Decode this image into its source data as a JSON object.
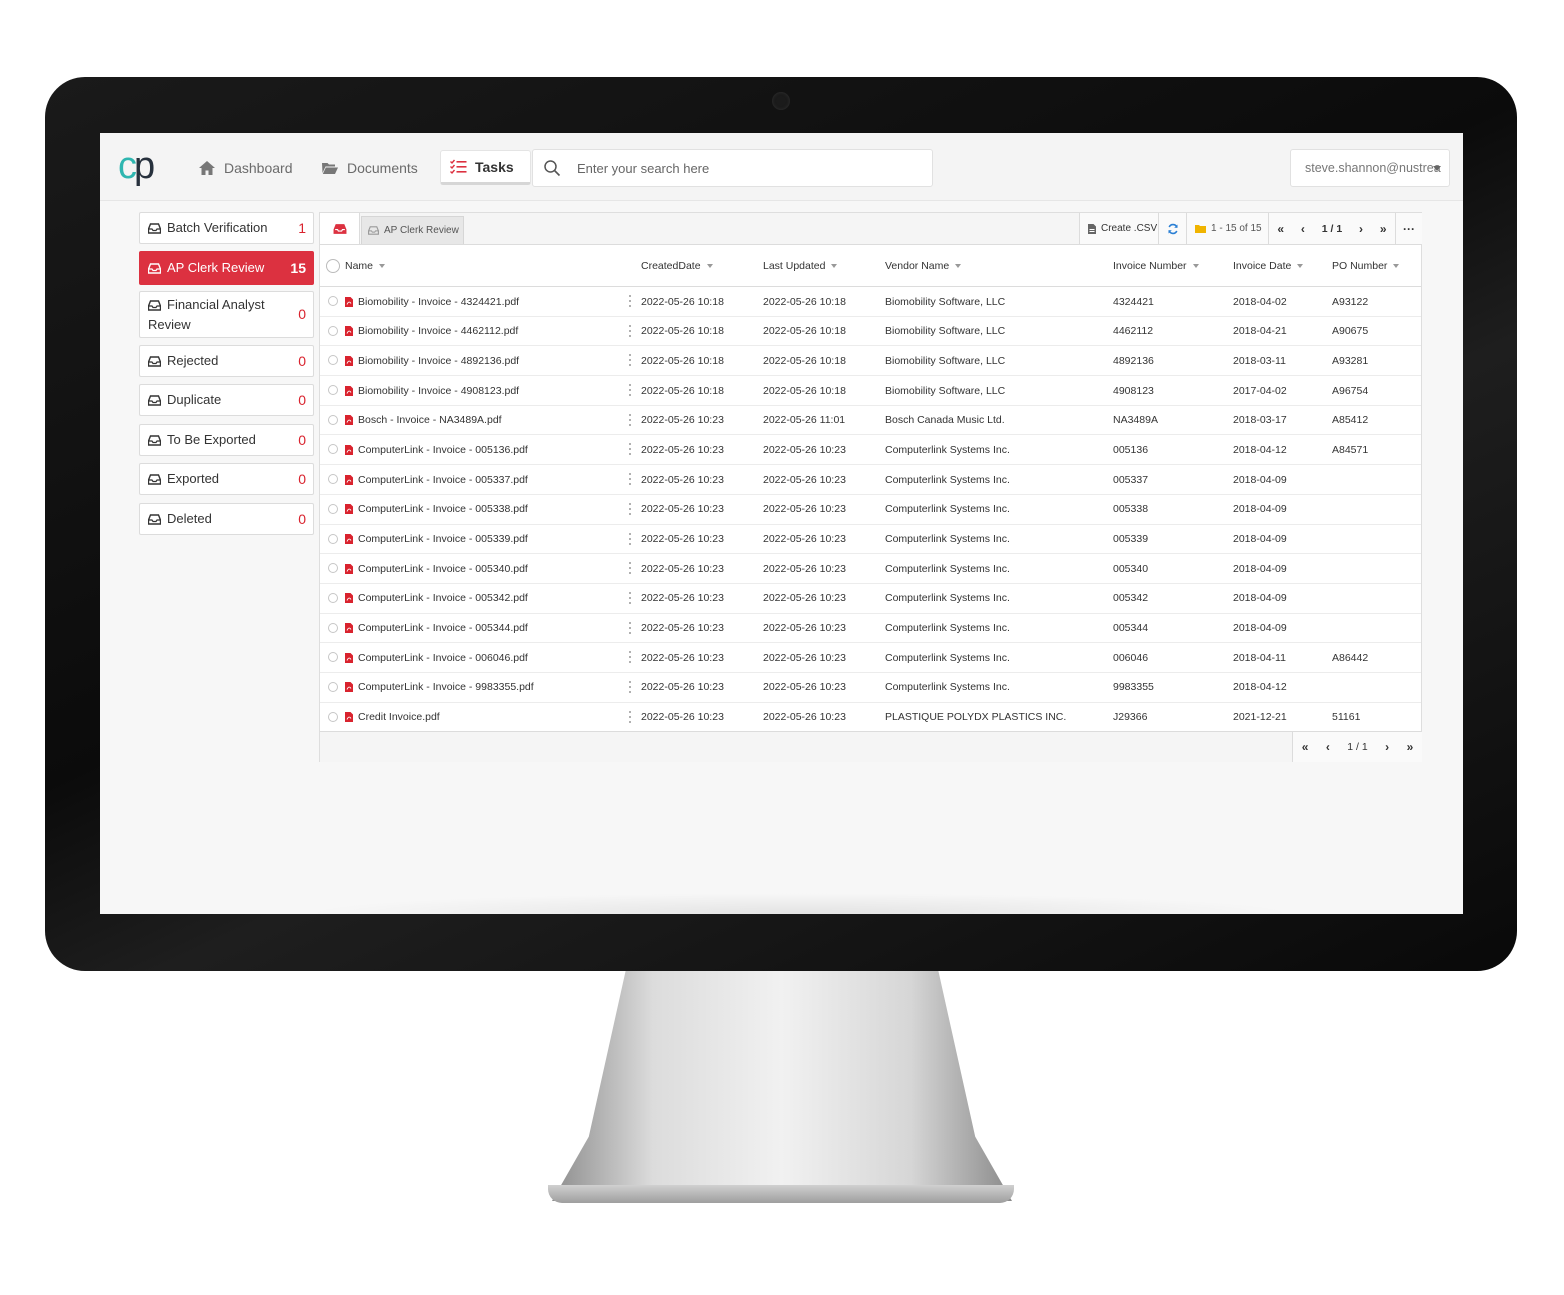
{
  "logo": {
    "c": "c",
    "p": "p"
  },
  "nav": {
    "dashboard": "Dashboard",
    "documents": "Documents",
    "tasks": "Tasks"
  },
  "search": {
    "placeholder": "Enter your search here"
  },
  "user": {
    "email": "steve.shannon@nustrea"
  },
  "queues": [
    {
      "label": "Batch Verification",
      "count": "1"
    },
    {
      "label": "AP Clerk Review",
      "count": "15"
    },
    {
      "label": "Financial Analyst Review",
      "count": "0"
    },
    {
      "label": "Rejected",
      "count": "0"
    },
    {
      "label": "Duplicate",
      "count": "0"
    },
    {
      "label": "To Be Exported",
      "count": "0"
    },
    {
      "label": "Exported",
      "count": "0"
    },
    {
      "label": "Deleted",
      "count": "0"
    }
  ],
  "toolbar": {
    "tab_label": "AP Clerk Review",
    "create_csv": "Create .CSV",
    "range": "1 - 15 of 15",
    "first": "«",
    "prev": "‹",
    "page": "1 / 1",
    "next": "›",
    "last": "»",
    "more": "···"
  },
  "columns": {
    "name": "Name",
    "created": "CreatedDate",
    "updated": "Last Updated",
    "vendor": "Vendor Name",
    "invoice_number": "Invoice Number",
    "invoice_date": "Invoice Date",
    "po": "PO Number"
  },
  "rows": [
    {
      "name": "Biomobility - Invoice - 4324421.pdf",
      "created": "2022-05-26 10:18",
      "updated": "2022-05-26 10:18",
      "vendor": "Biomobility Software, LLC",
      "inv": "4324421",
      "date": "2018-04-02",
      "po": "A93122"
    },
    {
      "name": "Biomobility - Invoice - 4462112.pdf",
      "created": "2022-05-26 10:18",
      "updated": "2022-05-26 10:18",
      "vendor": "Biomobility Software, LLC",
      "inv": "4462112",
      "date": "2018-04-21",
      "po": "A90675"
    },
    {
      "name": "Biomobility - Invoice - 4892136.pdf",
      "created": "2022-05-26 10:18",
      "updated": "2022-05-26 10:18",
      "vendor": "Biomobility Software, LLC",
      "inv": "4892136",
      "date": "2018-03-11",
      "po": "A93281"
    },
    {
      "name": "Biomobility - Invoice - 4908123.pdf",
      "created": "2022-05-26 10:18",
      "updated": "2022-05-26 10:18",
      "vendor": "Biomobility Software, LLC",
      "inv": "4908123",
      "date": "2017-04-02",
      "po": "A96754"
    },
    {
      "name": "Bosch - Invoice - NA3489A.pdf",
      "created": "2022-05-26 10:23",
      "updated": "2022-05-26 11:01",
      "vendor": "Bosch Canada Music Ltd.",
      "inv": "NA3489A",
      "date": "2018-03-17",
      "po": "A85412"
    },
    {
      "name": "ComputerLink - Invoice - 005136.pdf",
      "created": "2022-05-26 10:23",
      "updated": "2022-05-26 10:23",
      "vendor": "Computerlink Systems Inc.",
      "inv": "005136",
      "date": "2018-04-12",
      "po": "A84571"
    },
    {
      "name": "ComputerLink - Invoice - 005337.pdf",
      "created": "2022-05-26 10:23",
      "updated": "2022-05-26 10:23",
      "vendor": "Computerlink Systems Inc.",
      "inv": "005337",
      "date": "2018-04-09",
      "po": ""
    },
    {
      "name": "ComputerLink - Invoice - 005338.pdf",
      "created": "2022-05-26 10:23",
      "updated": "2022-05-26 10:23",
      "vendor": "Computerlink Systems Inc.",
      "inv": "005338",
      "date": "2018-04-09",
      "po": ""
    },
    {
      "name": "ComputerLink - Invoice - 005339.pdf",
      "created": "2022-05-26 10:23",
      "updated": "2022-05-26 10:23",
      "vendor": "Computerlink Systems Inc.",
      "inv": "005339",
      "date": "2018-04-09",
      "po": ""
    },
    {
      "name": "ComputerLink - Invoice - 005340.pdf",
      "created": "2022-05-26 10:23",
      "updated": "2022-05-26 10:23",
      "vendor": "Computerlink Systems Inc.",
      "inv": "005340",
      "date": "2018-04-09",
      "po": ""
    },
    {
      "name": "ComputerLink - Invoice - 005342.pdf",
      "created": "2022-05-26 10:23",
      "updated": "2022-05-26 10:23",
      "vendor": "Computerlink Systems Inc.",
      "inv": "005342",
      "date": "2018-04-09",
      "po": ""
    },
    {
      "name": "ComputerLink - Invoice - 005344.pdf",
      "created": "2022-05-26 10:23",
      "updated": "2022-05-26 10:23",
      "vendor": "Computerlink Systems Inc.",
      "inv": "005344",
      "date": "2018-04-09",
      "po": ""
    },
    {
      "name": "ComputerLink - Invoice - 006046.pdf",
      "created": "2022-05-26 10:23",
      "updated": "2022-05-26 10:23",
      "vendor": "Computerlink Systems Inc.",
      "inv": "006046",
      "date": "2018-04-11",
      "po": "A86442"
    },
    {
      "name": "ComputerLink - Invoice - 9983355.pdf",
      "created": "2022-05-26 10:23",
      "updated": "2022-05-26 10:23",
      "vendor": "Computerlink Systems Inc.",
      "inv": "9983355",
      "date": "2018-04-12",
      "po": ""
    },
    {
      "name": "Credit Invoice.pdf",
      "created": "2022-05-26 10:23",
      "updated": "2022-05-26 10:23",
      "vendor": "PLASTIQUE POLYDX PLASTICS INC.",
      "inv": "J29366",
      "date": "2021-12-21",
      "po": "51161"
    }
  ],
  "footer": {
    "first": "«",
    "prev": "‹",
    "page": "1 / 1",
    "next": "›",
    "last": "»"
  },
  "colors": {
    "accent": "#dc3140",
    "teal": "#2fb6b0",
    "pdf": "#d9232e",
    "refresh": "#2a7fd4",
    "folder": "#f0b400"
  }
}
